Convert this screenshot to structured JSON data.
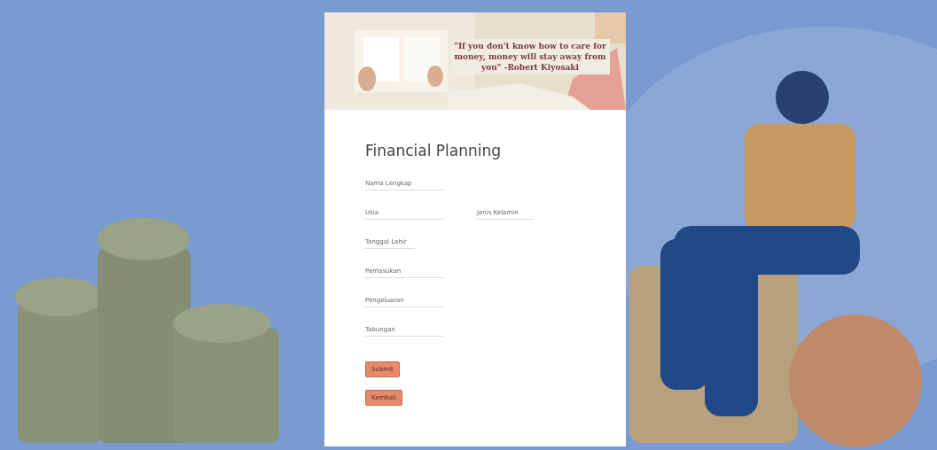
{
  "banner": {
    "quote": "\"If you don't know how to care for money, money will stay away from you\" -Robert Kiyosaki"
  },
  "form": {
    "title": "Financial Planning",
    "fields": [
      {
        "kind": "text",
        "placeholder": "Nama Lengkap"
      },
      {
        "kind": "pair",
        "items": [
          {
            "kind": "text",
            "placeholder": "Usia"
          },
          {
            "kind": "select",
            "label": "Jenis Kelamin"
          }
        ]
      },
      {
        "kind": "select",
        "label": "Tanggal Lahir"
      },
      {
        "kind": "text",
        "placeholder": "Pemasukan"
      },
      {
        "kind": "text",
        "placeholder": "Pengeluaran"
      },
      {
        "kind": "text",
        "placeholder": "Tabungan"
      }
    ],
    "buttons": [
      "Submit",
      "Kembali"
    ]
  }
}
